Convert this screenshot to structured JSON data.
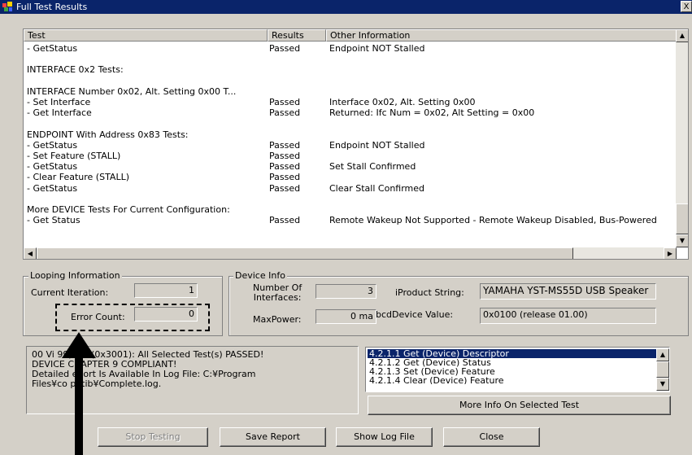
{
  "window": {
    "title": "Full Test Results",
    "close_glyph": "X"
  },
  "results": {
    "columns": [
      "Test",
      "Results",
      "Other Information"
    ],
    "rows": [
      [
        "- GetStatus",
        "Passed",
        "Endpoint NOT Stalled"
      ],
      [
        "",
        "",
        ""
      ],
      [
        "INTERFACE 0x2 Tests:",
        "",
        ""
      ],
      [
        "",
        "",
        ""
      ],
      [
        "INTERFACE Number 0x02, Alt. Setting 0x00 T...",
        "",
        ""
      ],
      [
        "- Set Interface",
        "Passed",
        "Interface 0x02, Alt. Setting 0x00"
      ],
      [
        "- Get Interface",
        "Passed",
        "Returned: Ifc Num = 0x02, Alt Setting = 0x00"
      ],
      [
        "",
        "",
        ""
      ],
      [
        "ENDPOINT With Address 0x83 Tests:",
        "",
        ""
      ],
      [
        "- GetStatus",
        "Passed",
        "Endpoint NOT Stalled"
      ],
      [
        "- Set Feature (STALL)",
        "Passed",
        ""
      ],
      [
        "- GetStatus",
        "Passed",
        "Set Stall Confirmed"
      ],
      [
        "- Clear Feature (STALL)",
        "Passed",
        ""
      ],
      [
        "- GetStatus",
        "Passed",
        "Clear Stall Confirmed"
      ],
      [
        "",
        "",
        ""
      ],
      [
        "More DEVICE Tests For Current Configuration:",
        "",
        ""
      ],
      [
        "- Get Status",
        "Passed",
        "Remote Wakeup Not Supported - Remote Wakeup Disabled, Bus-Powered"
      ]
    ]
  },
  "looping": {
    "group_label": "Looping Information",
    "current_iteration_label": "Current Iteration:",
    "current_iteration_value": "1",
    "error_count_label": "Error Count:",
    "error_count_value": "0"
  },
  "device": {
    "group_label": "Device Info",
    "num_interfaces_label": "Number Of\nInterfaces:",
    "num_interfaces_value": "3",
    "max_power_label": "MaxPower:",
    "max_power_value": "0 ma",
    "iproduct_label": "iProduct String:",
    "iproduct_value": "YAMAHA YST-MS55D USB Speaker",
    "bcd_label": "bcdDevice Value:",
    "bcd_value": "0x0100 (release 01.00)"
  },
  "message": [
    "00 Vi    99) Pid (0x3001): All Selected Test(s) PASSED!",
    "DEVICE    CHAPTER 9 COMPLIANT!",
    "Detailed  eport Is Available In Log File: C:¥Program",
    "Files¥co  patib¥Complete.log."
  ],
  "test_list": {
    "items": [
      "4.2.1.1 Get (Device) Descriptor",
      "4.2.1.2 Get (Device) Status",
      "4.2.1.3 Set (Device) Feature",
      "4.2.1.4 Clear (Device) Feature"
    ],
    "selected_index": 0
  },
  "buttons": {
    "more_info": "More Info On Selected Test",
    "stop": "Stop Testing",
    "save": "Save Report",
    "show_log": "Show Log File",
    "close": "Close"
  },
  "icons": {
    "app": "usb-app-icon",
    "scroll_up": "arrow-up-icon",
    "scroll_down": "arrow-down-icon",
    "scroll_left": "arrow-left-icon",
    "scroll_right": "arrow-right-icon"
  }
}
